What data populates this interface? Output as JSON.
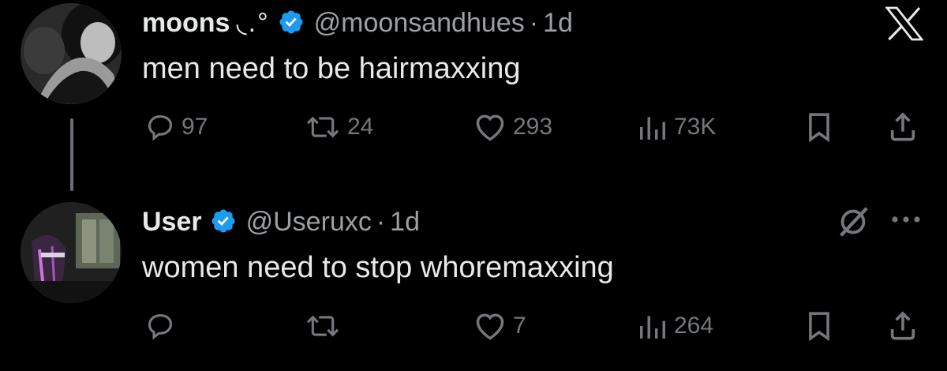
{
  "posts": [
    {
      "name": "moons",
      "name_decoration": "◟.°",
      "handle": "@moonsandhues",
      "separator": "·",
      "time": "1d",
      "text": "men need to be hairmaxxing",
      "stats": {
        "replies": "97",
        "reposts": "24",
        "likes": "293",
        "views": "73K"
      }
    },
    {
      "name": "User",
      "handle": "@Useruxc",
      "separator": "·",
      "time": "1d",
      "text": "women need to stop whoremaxxing",
      "stats": {
        "replies": "",
        "reposts": "",
        "likes": "7",
        "views": "264"
      }
    }
  ],
  "icons": {
    "brand": "x-logo-icon",
    "reply": "speech-bubble-icon",
    "repost": "repost-arrows-icon",
    "like": "heart-icon",
    "views": "bar-chart-icon",
    "bookmark": "bookmark-icon",
    "share": "share-upload-icon",
    "grok": "grok-slash-circle-icon",
    "more": "more-dots-icon"
  },
  "colors": {
    "background": "#000000",
    "text": "#e7e9ea",
    "secondary": "#74787c",
    "verified": "#1d9bf0"
  }
}
